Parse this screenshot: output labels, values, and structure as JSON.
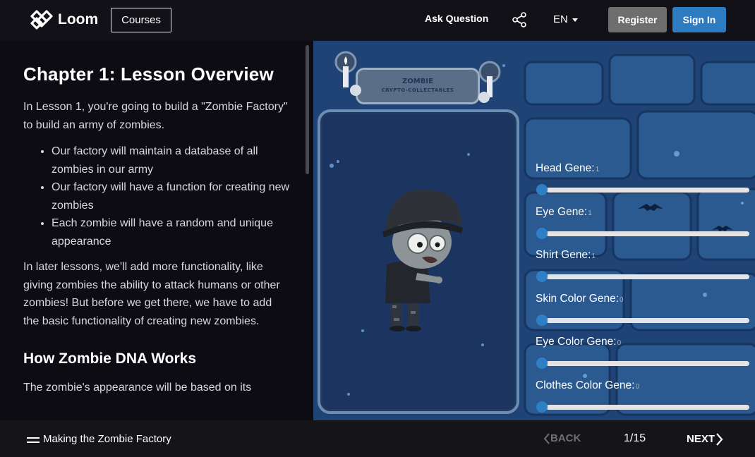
{
  "header": {
    "brand": "Loom",
    "courses_label": "Courses",
    "ask_label": "Ask Question",
    "share_icon": "share-icon",
    "language": "EN",
    "register_label": "Register",
    "signin_label": "Sign In"
  },
  "lesson": {
    "title": "Chapter 1: Lesson Overview",
    "intro": "In Lesson 1, you're going to build a \"Zombie Factory\" to build an army of zombies.",
    "bullets": [
      "Our factory will maintain a database of all zombies in our army",
      "Our factory will have a function for creating new zombies",
      "Each zombie will have a random and unique appearance"
    ],
    "paragraph2": "In later lessons, we'll add more functionality, like giving zombies the ability to attack humans or other zombies! But before we get there, we have to add the basic functionality of creating new zombies.",
    "section_title": "How Zombie DNA Works",
    "paragraph3": "The zombie's appearance will be based on its"
  },
  "panel": {
    "banner_title": "ZOMBIE",
    "banner_subtitle": "CRYPTO-COLLECTABLES",
    "genes": [
      {
        "label": "Head Gene:",
        "value": "1"
      },
      {
        "label": "Eye Gene:",
        "value": "1"
      },
      {
        "label": "Shirt Gene:",
        "value": "1"
      },
      {
        "label": "Skin Color Gene:",
        "value": "0"
      },
      {
        "label": "Eye Color Gene:",
        "value": "0"
      },
      {
        "label": "Clothes Color Gene:",
        "value": "0"
      }
    ]
  },
  "footer": {
    "course_title": "Making the Zombie Factory",
    "back_label": "BACK",
    "page": "1/15",
    "next_label": "NEXT"
  },
  "colors": {
    "accent": "#2d7bc0",
    "register": "#6e6e6e",
    "panel_bg": "#1b3d6a"
  }
}
